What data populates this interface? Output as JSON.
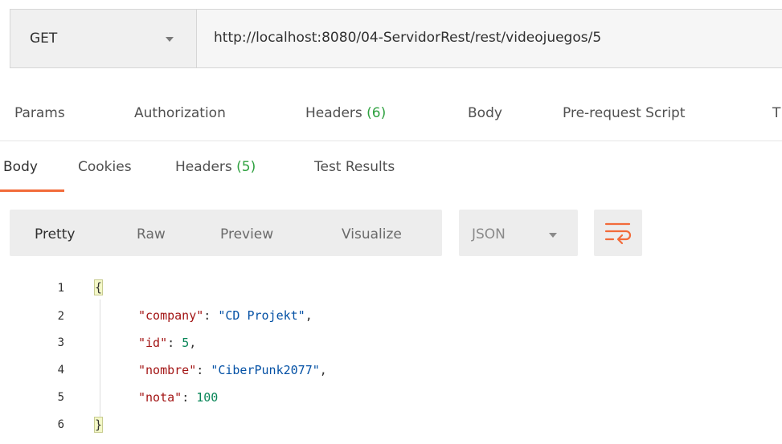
{
  "request": {
    "method": "GET",
    "url": "http://localhost:8080/04-ServidorRest/rest/videojuegos/5"
  },
  "request_tabs": [
    {
      "label": "Params"
    },
    {
      "label": "Authorization"
    },
    {
      "label": "Headers",
      "count": "(6)"
    },
    {
      "label": "Body"
    },
    {
      "label": "Pre-request Script"
    },
    {
      "label": "T"
    }
  ],
  "response_tabs": [
    {
      "label": "Body",
      "active": true
    },
    {
      "label": "Cookies"
    },
    {
      "label": "Headers",
      "count": "(5)"
    },
    {
      "label": "Test Results"
    }
  ],
  "view_modes": [
    "Pretty",
    "Raw",
    "Preview",
    "Visualize"
  ],
  "active_view": "Pretty",
  "format": "JSON",
  "icons": {
    "wrap": "wrap-lines-icon",
    "method_caret": "chevron-down-icon",
    "format_caret": "chevron-down-icon"
  },
  "colors": {
    "accent": "#f26b3a",
    "count_green": "#2fa140",
    "wrap_icon": "#f26b3a"
  },
  "code": {
    "line_numbers": [
      "1",
      "2",
      "3",
      "4",
      "5",
      "6"
    ],
    "open_brace": "{",
    "close_brace": "}",
    "fields": [
      {
        "key": "\"company\"",
        "sep": ": ",
        "value": "\"CD Projekt\"",
        "trail": ",",
        "vtype": "str"
      },
      {
        "key": "\"id\"",
        "sep": ": ",
        "value": "5",
        "trail": ",",
        "vtype": "num"
      },
      {
        "key": "\"nombre\"",
        "sep": ": ",
        "value": "\"CiberPunk2077\"",
        "trail": ",",
        "vtype": "str"
      },
      {
        "key": "\"nota\"",
        "sep": ": ",
        "value": "100",
        "trail": "",
        "vtype": "num"
      }
    ]
  }
}
